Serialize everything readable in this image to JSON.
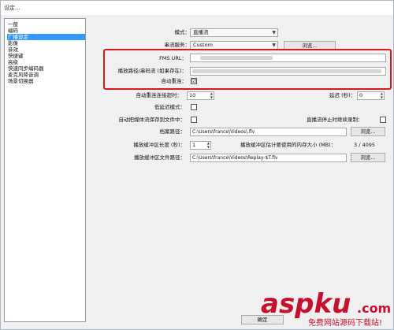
{
  "window": {
    "title": "设定..."
  },
  "sidebar": {
    "items": [
      {
        "label": "一般",
        "selected": false
      },
      {
        "label": "编码",
        "selected": false
      },
      {
        "label": "广播设定",
        "selected": true
      },
      {
        "label": "影像",
        "selected": false
      },
      {
        "label": "音效",
        "selected": false
      },
      {
        "label": "快捷键",
        "selected": false
      },
      {
        "label": "高级",
        "selected": false
      },
      {
        "label": "快速同步编码器",
        "selected": false
      },
      {
        "label": "麦克风降音调",
        "selected": false
      },
      {
        "label": "场景切换器",
        "selected": false
      }
    ]
  },
  "form": {
    "mode_label": "模式：",
    "mode_value": "直播流",
    "service_label": "串流服务：",
    "service_value": "Custom",
    "browse_label": "浏览...",
    "fms_url_label": "FMS URL：",
    "playpath_label": "播放路径/串码流 (如果存在)：",
    "auto_reconnect_label": "自动重连：",
    "auto_reconnect_checked": "☑",
    "reconnect_timeout_label": "自动重连连接超时：",
    "reconnect_timeout_value": "10",
    "delay_label": "延迟 (秒)：",
    "delay_value": "0",
    "low_latency_label": "低延迟模式：",
    "save_to_file_label": "自动把媒体流保存到文件中：",
    "continue_label": "直播流停止时继续录制：",
    "file_path_label": "档案路径：",
    "file_path_value": "C:\\Users\\france\\Videos\\.flv",
    "file_browse_label": "浏览...",
    "buffer_len_label": "播放缓冲区长度 (秒)：",
    "buffer_len_value": "1",
    "buffer_mem_label": "播放缓冲区估计要使用的内存大小 (MB)：",
    "buffer_mem_value": "3 / 4095",
    "buffer_file_label": "播放缓冲区文件路径：",
    "buffer_file_value": "C:\\Users\\france\\Videos\\Replay-$T.flv",
    "buffer_browse_label": "浏览..."
  },
  "footer": {
    "ok_label": "确定"
  },
  "watermark": {
    "brand": "aspku",
    "suffix": ".com",
    "slogan": "免费网站源码下载站!"
  },
  "colors": {
    "accent": "#3399ff",
    "highlight": "#d71920",
    "watermark": "#c8102e"
  }
}
